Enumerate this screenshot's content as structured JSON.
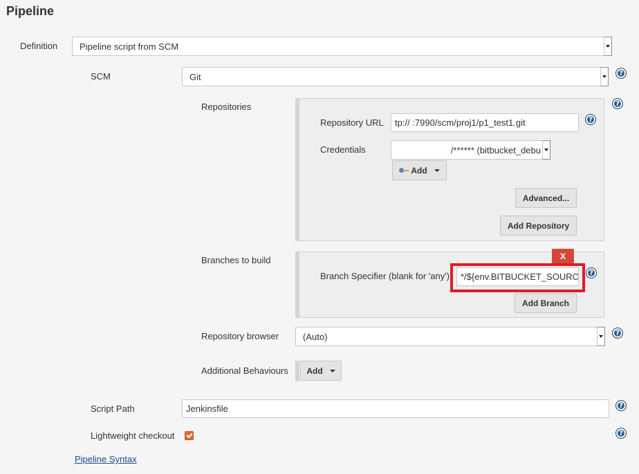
{
  "section_title": "Pipeline",
  "definition": {
    "label": "Definition",
    "value": "Pipeline script from SCM"
  },
  "scm": {
    "label": "SCM",
    "value": "Git"
  },
  "repositories": {
    "label": "Repositories",
    "url_label": "Repository URL",
    "url_value": "tp://                    :7990/scm/proj1/p1_test1.git",
    "credentials_label": "Credentials",
    "credentials_value": "/****** (bitbucket_debu",
    "add_label": "Add",
    "advanced_label": "Advanced...",
    "add_repository_label": "Add Repository"
  },
  "branches": {
    "label": "Branches to build",
    "delete_label": "X",
    "specifier_label": "Branch Specifier (blank for 'any')",
    "specifier_value": "*/${env.BITBUCKET_SOURCE",
    "add_branch_label": "Add Branch"
  },
  "repository_browser": {
    "label": "Repository browser",
    "value": "(Auto)"
  },
  "additional_behaviours": {
    "label": "Additional Behaviours",
    "add_label": "Add"
  },
  "script_path": {
    "label": "Script Path",
    "value": "Jenkinsfile"
  },
  "lightweight_checkout": {
    "label": "Lightweight checkout",
    "checked": true
  },
  "pipeline_syntax_link": "Pipeline Syntax",
  "help_glyph": "?",
  "colors": {
    "highlight": "#e01c24",
    "delete_button": "#d24939",
    "checkbox": "#e06a34",
    "link": "#204a87"
  }
}
